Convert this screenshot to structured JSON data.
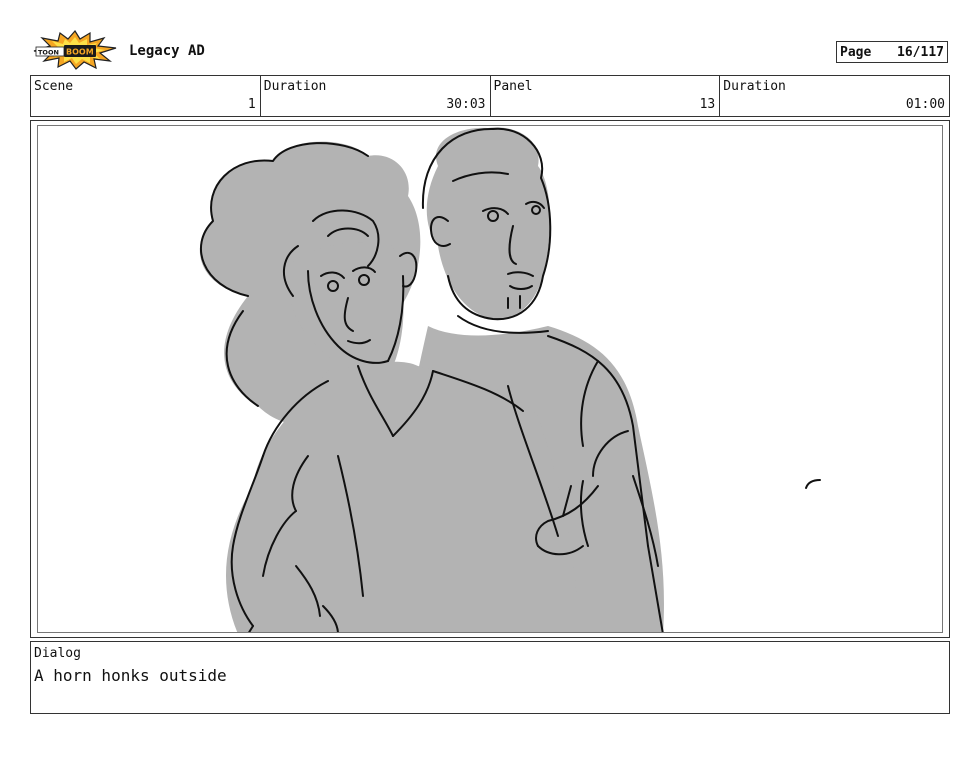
{
  "header": {
    "logo_text": "TOON BOOM",
    "project_title": "Legacy AD",
    "page_label": "Page",
    "page_value": "16/117"
  },
  "info": [
    {
      "label": "Scene",
      "value": "1"
    },
    {
      "label": "Duration",
      "value": "30:03"
    },
    {
      "label": "Panel",
      "value": "13"
    },
    {
      "label": "Duration",
      "value": "01:00"
    }
  ],
  "dialog": {
    "label": "Dialog",
    "text": "A horn honks outside"
  }
}
